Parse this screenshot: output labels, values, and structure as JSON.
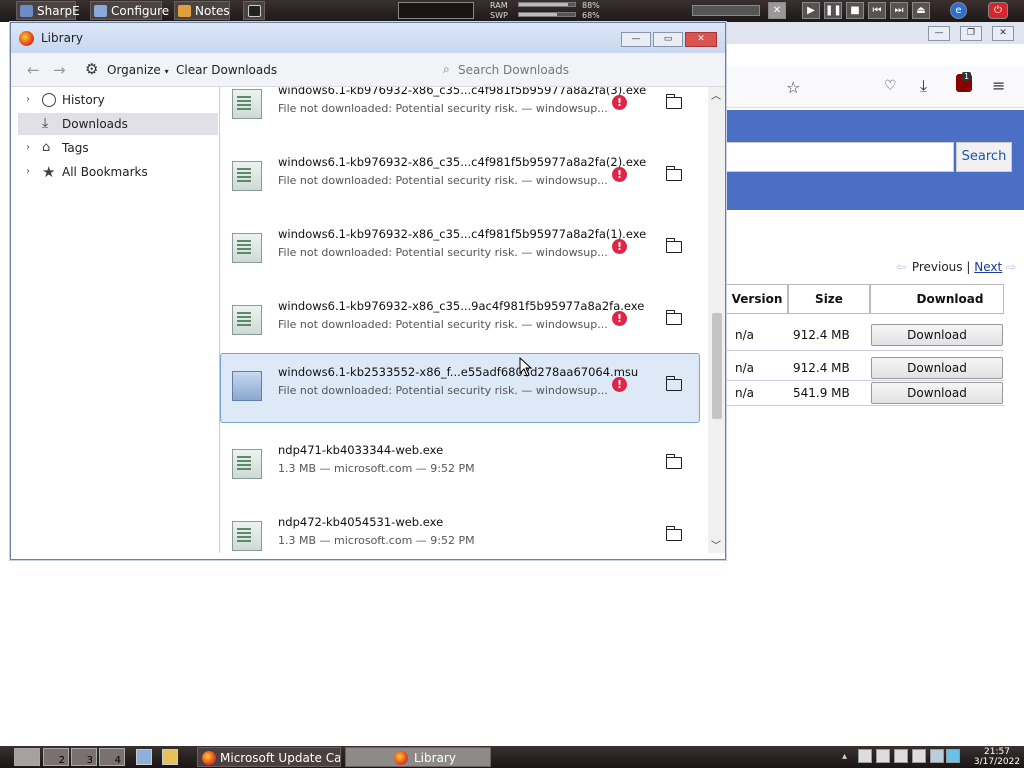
{
  "top_panel": {
    "launchers": [
      "SharpE",
      "Configure",
      "Notes"
    ],
    "ram_label": "RAM",
    "swp_label": "SWP",
    "ram_pct": "88%",
    "swp_pct": "68%",
    "ram_fraction": 0.88,
    "swp_fraction": 0.68,
    "media_controls": [
      "play-icon",
      "pause-icon",
      "stop-icon",
      "previous-icon",
      "next-icon"
    ]
  },
  "background_window": {
    "search_button": "Search",
    "pager_previous": "Previous",
    "pager_separator": "|",
    "pager_next": "Next",
    "table": {
      "headers": [
        "Version",
        "Size",
        "Download"
      ],
      "rows": [
        {
          "version": "n/a",
          "size": "912.4 MB",
          "action": "Download"
        },
        {
          "version": "n/a",
          "size": "912.4 MB",
          "action": "Download"
        },
        {
          "version": "n/a",
          "size": "541.9 MB",
          "action": "Download"
        }
      ]
    },
    "extension_badge": "1"
  },
  "library": {
    "title": "Library",
    "toolbar": {
      "organize": "Organize",
      "clear_downloads": "Clear Downloads",
      "search_placeholder": "Search Downloads"
    },
    "sidebar": [
      {
        "label": "History",
        "icon": "clock-icon",
        "expandable": true
      },
      {
        "label": "Downloads",
        "icon": "download-icon",
        "expandable": false,
        "selected": true
      },
      {
        "label": "Tags",
        "icon": "tag-icon",
        "expandable": true
      },
      {
        "label": "All Bookmarks",
        "icon": "star-icon",
        "expandable": true
      }
    ],
    "downloads": [
      {
        "name": "windows6.1-kb976932-x86_c35...c4f981f5b95977a8a2fa(3).exe",
        "status": "File not downloaded: Potential security risk. — windowsup...",
        "blocked": true
      },
      {
        "name": "windows6.1-kb976932-x86_c35...c4f981f5b95977a8a2fa(2).exe",
        "status": "File not downloaded: Potential security risk. — windowsup...",
        "blocked": true
      },
      {
        "name": "windows6.1-kb976932-x86_c35...c4f981f5b95977a8a2fa(1).exe",
        "status": "File not downloaded: Potential security risk. — windowsup...",
        "blocked": true
      },
      {
        "name": "windows6.1-kb976932-x86_c35...9ac4f981f5b95977a8a2fa.exe",
        "status": "File not downloaded: Potential security risk. — windowsup...",
        "blocked": true
      },
      {
        "name": "windows6.1-kb2533552-x86_f...e55adf6803d278aa67064.msu",
        "status": "File not downloaded: Potential security risk. — windowsup...",
        "blocked": true,
        "selected": true
      },
      {
        "name": "ndp471-kb4033344-web.exe",
        "status": "1.3 MB — microsoft.com — 9:52 PM",
        "blocked": false
      },
      {
        "name": "ndp472-kb4054531-web.exe",
        "status": "1.3 MB — microsoft.com — 9:52 PM",
        "blocked": false
      }
    ]
  },
  "taskbar": {
    "workspaces": [
      "2",
      "3",
      "4"
    ],
    "windows": [
      {
        "label": "Microsoft Update Cat...",
        "active": false
      },
      {
        "label": "Library",
        "active": true
      }
    ],
    "clock_time": "21:57",
    "clock_date": "3/17/2022"
  }
}
